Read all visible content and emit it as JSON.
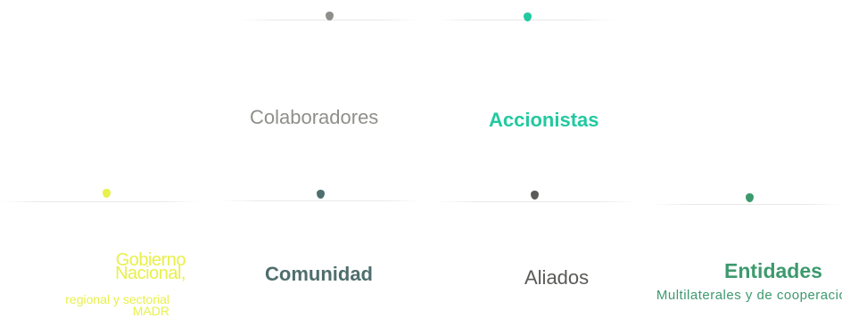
{
  "colors": {
    "colaboradores": "#8f8f8a",
    "accionistas": "#22c9a0",
    "gobierno": "#e8f04a",
    "comunidad": "#4f6e6e",
    "aliados": "#5a5a58",
    "entidades": "#3d9a6e",
    "line": "#e8e8e8"
  },
  "nodes": {
    "colaboradores": {
      "label": "Colaboradores"
    },
    "accionistas": {
      "label": "Accionistas"
    },
    "gobierno": {
      "label": "Gobierno Nacional,",
      "sublabel": "regional y sectorial MADR"
    },
    "comunidad": {
      "label": "Comunidad"
    },
    "aliados": {
      "label": "Aliados"
    },
    "entidades": {
      "label": "Entidades",
      "sublabel": "Multilaterales y de cooperación"
    }
  }
}
